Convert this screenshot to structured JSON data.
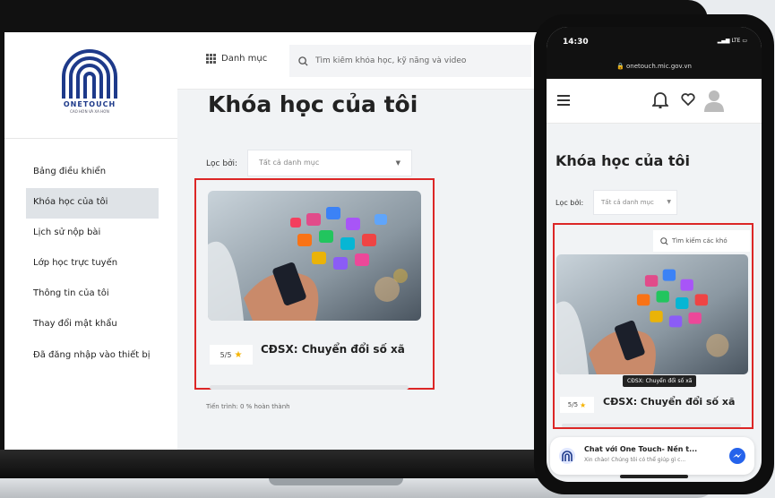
{
  "laptop": {
    "logo": {
      "brand": "ONETOUCH",
      "tagline": "CAO HƠN VÀ XA HƠN"
    },
    "sidebar": {
      "items": [
        {
          "label": "Bảng điều khiển",
          "active": false
        },
        {
          "label": "Khóa học của tôi",
          "active": true
        },
        {
          "label": "Lịch sử nộp bài",
          "active": false
        },
        {
          "label": "Lớp học trực tuyến",
          "active": false
        },
        {
          "label": "Thông tin của tôi",
          "active": false
        },
        {
          "label": "Thay đổi mật khẩu",
          "active": false
        },
        {
          "label": "Đã đăng nhập vào thiết bị",
          "active": false
        }
      ]
    },
    "topbar": {
      "category_label": "Danh mục",
      "search_placeholder": "Tìm kiếm khóa học, kỹ năng và video"
    },
    "main": {
      "title": "Khóa học của tôi",
      "filter_label": "Lọc bởi:",
      "filter_value": "Tất cả danh mục",
      "course": {
        "rating": "5/5",
        "title": "CĐSX: Chuyển đổi số xã"
      },
      "progress_text": "Tiến trình: 0 % hoàn thành"
    }
  },
  "phone": {
    "time": "14:30",
    "status_indicators": "LTE",
    "url": "onetouch.mic.gov.vn",
    "title": "Khóa học của tôi",
    "filter_label": "Lọc bởi:",
    "filter_value": "Tất cả danh mục",
    "search_placeholder": "Tìm kiếm các khó",
    "course": {
      "rating": "5/5",
      "title": "CĐSX: Chuyển đổi số xã",
      "tooltip": "CĐSX: Chuyển đổi số xã"
    },
    "chat": {
      "title": "Chat với One Touch- Nền t...",
      "subtitle": "Xin chào! Chúng tôi có thể giúp gì c..."
    }
  },
  "colors": {
    "brand": "#1e3a8a",
    "highlight": "#dc2626",
    "star": "#f5b301",
    "active_menu": "#dfe3e7"
  }
}
